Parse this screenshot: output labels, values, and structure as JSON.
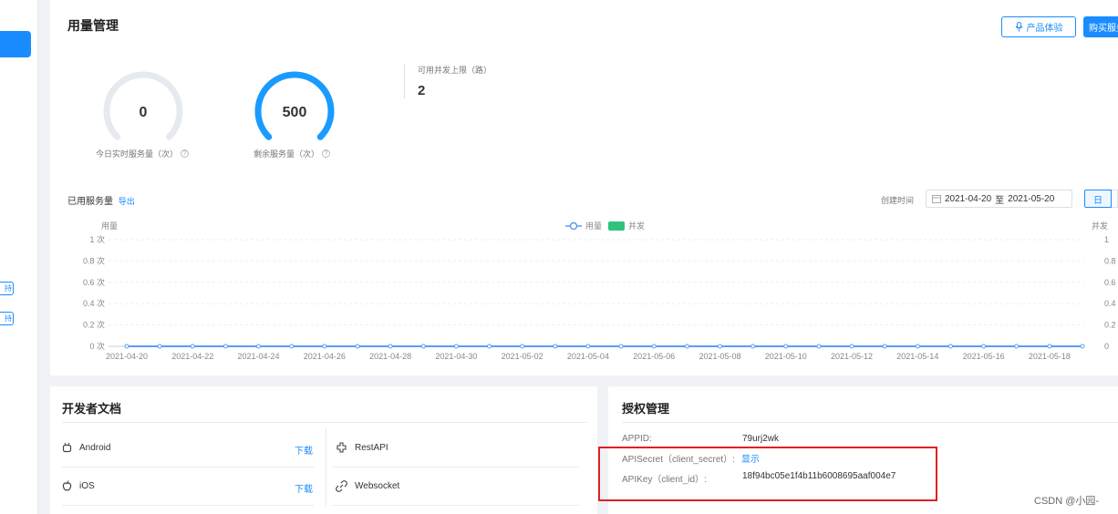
{
  "sidebar": {
    "mini_buttons": [
      "持",
      "持"
    ]
  },
  "usage": {
    "title": "用量管理",
    "product_trial_label": "产品体验",
    "buy_label": "购买服务",
    "gauge_today": {
      "value": "0",
      "label": "今日实时服务量（次）",
      "fraction": 0
    },
    "gauge_remaining": {
      "value": "500",
      "label": "剩余服务量（次）",
      "fraction": 1
    },
    "concurrency": {
      "label": "可用并发上限（路）",
      "value": "2"
    },
    "used_label": "已用服务量",
    "export_label": "导出",
    "created_time_label": "创建时间",
    "date_range": {
      "start": "2021-04-20",
      "sep": "至",
      "end": "2021-05-20"
    },
    "day_button": "日"
  },
  "chart_data": {
    "type": "line",
    "ylabel_left": "用量",
    "ylabel_right": "并发",
    "legend": [
      {
        "name": "用量",
        "color": "#5b9cf5",
        "style": "line-circle"
      },
      {
        "name": "并发",
        "color": "#2ec27e",
        "style": "box"
      }
    ],
    "y_ticks_left": [
      "1 次",
      "0.8 次",
      "0.6 次",
      "0.4 次",
      "0.2 次",
      "0 次"
    ],
    "y_ticks_right": [
      "1",
      "0.8",
      "0.6",
      "0.4",
      "0.2",
      "0"
    ],
    "ylim": [
      0,
      1
    ],
    "x_tick_labels": [
      "2021-04-20",
      "2021-04-22",
      "2021-04-24",
      "2021-04-26",
      "2021-04-28",
      "2021-04-30",
      "2021-05-02",
      "2021-05-04",
      "2021-05-06",
      "2021-05-08",
      "2021-05-10",
      "2021-05-12",
      "2021-05-14",
      "2021-05-16",
      "2021-05-18"
    ],
    "x": [
      "2021-04-20",
      "2021-04-21",
      "2021-04-22",
      "2021-04-23",
      "2021-04-24",
      "2021-04-25",
      "2021-04-26",
      "2021-04-27",
      "2021-04-28",
      "2021-04-29",
      "2021-04-30",
      "2021-05-01",
      "2021-05-02",
      "2021-05-03",
      "2021-05-04",
      "2021-05-05",
      "2021-05-06",
      "2021-05-07",
      "2021-05-08",
      "2021-05-09",
      "2021-05-10",
      "2021-05-11",
      "2021-05-12",
      "2021-05-13",
      "2021-05-14",
      "2021-05-15",
      "2021-05-16",
      "2021-05-17",
      "2021-05-18",
      "2021-05-19"
    ],
    "series": [
      {
        "name": "用量",
        "values": [
          0,
          0,
          0,
          0,
          0,
          0,
          0,
          0,
          0,
          0,
          0,
          0,
          0,
          0,
          0,
          0,
          0,
          0,
          0,
          0,
          0,
          0,
          0,
          0,
          0,
          0,
          0,
          0,
          0,
          0
        ]
      }
    ],
    "grid": true
  },
  "docs": {
    "title": "开发者文档",
    "items": [
      {
        "label": "Android",
        "icon": "android-icon",
        "download": "下载"
      },
      {
        "label": "iOS",
        "icon": "apple-icon",
        "download": "下载"
      },
      {
        "label": "RestAPI",
        "icon": "puzzle-icon"
      },
      {
        "label": "Websocket",
        "icon": "link-icon"
      }
    ]
  },
  "auth": {
    "title": "授权管理",
    "appid_key": "APPID:",
    "appid_val": "79urj2wk",
    "secret_key": "APISecret（client_secret）:",
    "secret_val": "显示",
    "apikey_key": "APIKey（client_id）:",
    "apikey_val": "18f94bc05e1f4b11b6008695aaf004e7"
  },
  "watermark": "CSDN @小园-"
}
